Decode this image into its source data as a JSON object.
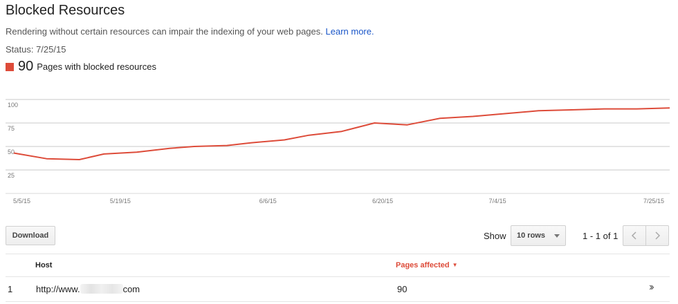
{
  "header": {
    "title": "Blocked Resources",
    "subtitle": "Rendering without certain resources can impair the indexing of your web pages.",
    "learn_more": "Learn more.",
    "status": "Status: 7/25/15"
  },
  "metric": {
    "value": "90",
    "label": "Pages with blocked resources",
    "color": "#dd4b39"
  },
  "chart_data": {
    "type": "line",
    "title": "",
    "xlabel": "",
    "ylabel": "",
    "ylim": [
      0,
      100
    ],
    "yticks": [
      25,
      50,
      75,
      100
    ],
    "xtick_labels": [
      "5/5/15",
      "5/19/15",
      "6/6/15",
      "6/20/15",
      "7/4/15",
      "7/25/15"
    ],
    "grid": true,
    "series": [
      {
        "color": "#dd4b39",
        "x": [
          "5/6/15",
          "5/10/15",
          "5/14/15",
          "5/17/15",
          "5/21/15",
          "5/25/15",
          "5/28/15",
          "6/1/15",
          "6/4/15",
          "6/8/15",
          "6/11/15",
          "6/15/15",
          "6/19/15",
          "6/23/15",
          "6/27/15",
          "7/1/15",
          "7/5/15",
          "7/9/15",
          "7/13/15",
          "7/17/15",
          "7/21/15",
          "7/25/15"
        ],
        "values": [
          43,
          37,
          36,
          42,
          44,
          48,
          50,
          51,
          54,
          57,
          62,
          66,
          75,
          73,
          80,
          82,
          85,
          88,
          89,
          90,
          90,
          91
        ]
      }
    ]
  },
  "toolbar": {
    "download_label": "Download",
    "show_label": "Show",
    "rows_selected": "10 rows",
    "pager_text": "1 - 1 of 1"
  },
  "table": {
    "headers": {
      "host": "Host",
      "pages": "Pages affected"
    },
    "rows": [
      {
        "index": "1",
        "host_prefix": "http://www.",
        "host_suffix": "com",
        "pages": "90"
      }
    ]
  },
  "icons": {
    "prev": "chevron-left-icon",
    "next": "chevron-right-icon",
    "sort": "sort-desc-icon",
    "row_action": "double-chevron-right-icon"
  }
}
